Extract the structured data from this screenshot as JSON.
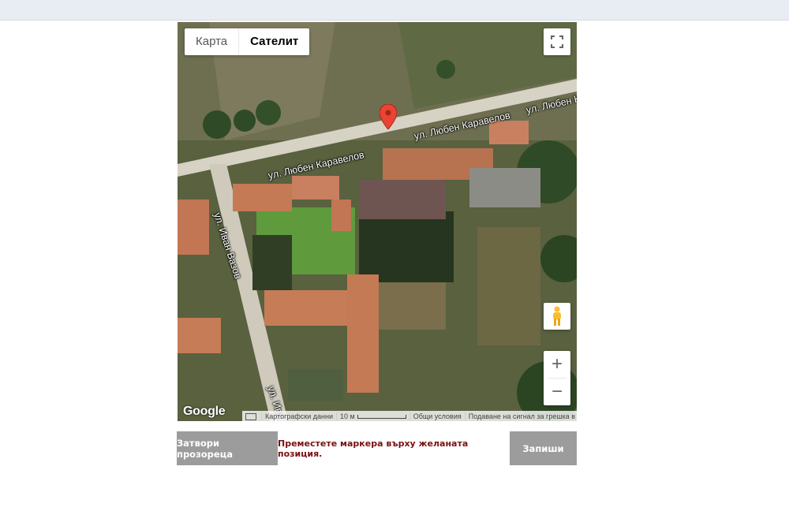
{
  "map": {
    "type_buttons": {
      "map": "Карта",
      "satellite": "Сателит"
    },
    "streets": {
      "karavelov": "ул. Любен Каравелов",
      "karavelov_2": "ул. Любен Каравелов",
      "karavelov_3": "ул. Любен К",
      "vazov": "ул. Иван Вазов",
      "vazov_2": "ул. Ива"
    },
    "logo": "Google",
    "footer": {
      "map_data": "Картографски данни",
      "scale": "10 м",
      "terms": "Общи условия",
      "report": "Подаване на сигнал за грешка в картата"
    },
    "zoom_in": "+",
    "zoom_out": "−"
  },
  "actions": {
    "close_label": "Затвори прозореца",
    "message": "Преместете маркера върху желаната позиция.",
    "save_label": "Запиши"
  },
  "colors": {
    "button_bg": "#9c9c9c",
    "message_text": "#7a1010",
    "marker": "#ea4335"
  }
}
